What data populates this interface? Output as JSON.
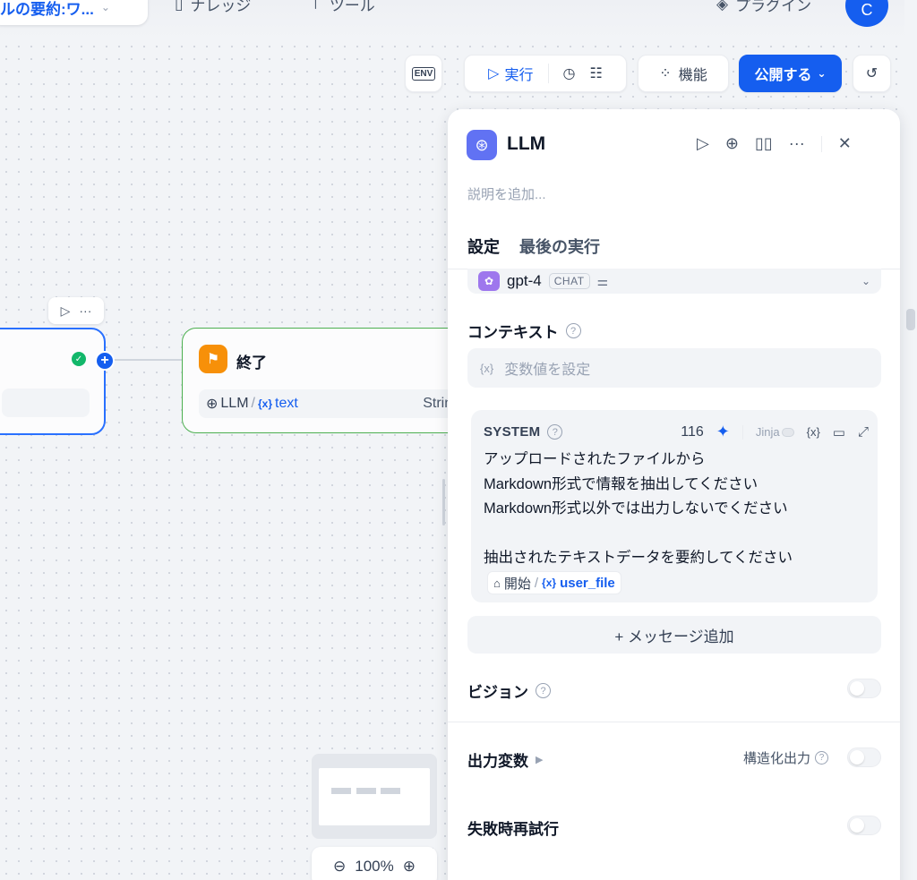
{
  "topbar": {
    "app_title": "ルの要約:ワ...",
    "nav_knowledge": "ナレッジ",
    "nav_tools": "ツール",
    "nav_plugins": "プラグイン",
    "avatar_initial": "C"
  },
  "toolbar": {
    "env_label": "ENV",
    "run_label": "実行",
    "features_label": "機能",
    "publish_label": "公開する"
  },
  "canvas": {
    "end_node_title": "終了",
    "end_node_var_source": "LLM",
    "end_node_var_name": "text",
    "end_node_var_type": "String",
    "zoom_level": "100%"
  },
  "panel": {
    "title": "LLM",
    "description_placeholder": "説明を追加...",
    "tabs": [
      "設定",
      "最後の実行"
    ],
    "model": {
      "name": "gpt-4",
      "badge": "CHAT"
    },
    "context_label": "コンテキスト",
    "context_placeholder": "変数値を設定",
    "system": {
      "label": "SYSTEM",
      "token_count": "116",
      "jinja_label": "Jinja",
      "lines": [
        "アップロードされたファイルから",
        "Markdown形式で情報を抽出してください",
        "Markdown形式以外では出力しないでください",
        "",
        "抽出されたテキストデータを要約してください"
      ],
      "var_source": "開始",
      "var_name": "user_file"
    },
    "add_message_label": "+ メッセージ追加",
    "vision_label": "ビジョン",
    "output_vars_label": "出力変数",
    "structured_output_label": "構造化出力",
    "retry_label": "失敗時再試行"
  },
  "colors": {
    "accent": "#155eef",
    "llm_icon": "#6172f3",
    "end_icon": "#f79009",
    "success": "#12b76a"
  }
}
